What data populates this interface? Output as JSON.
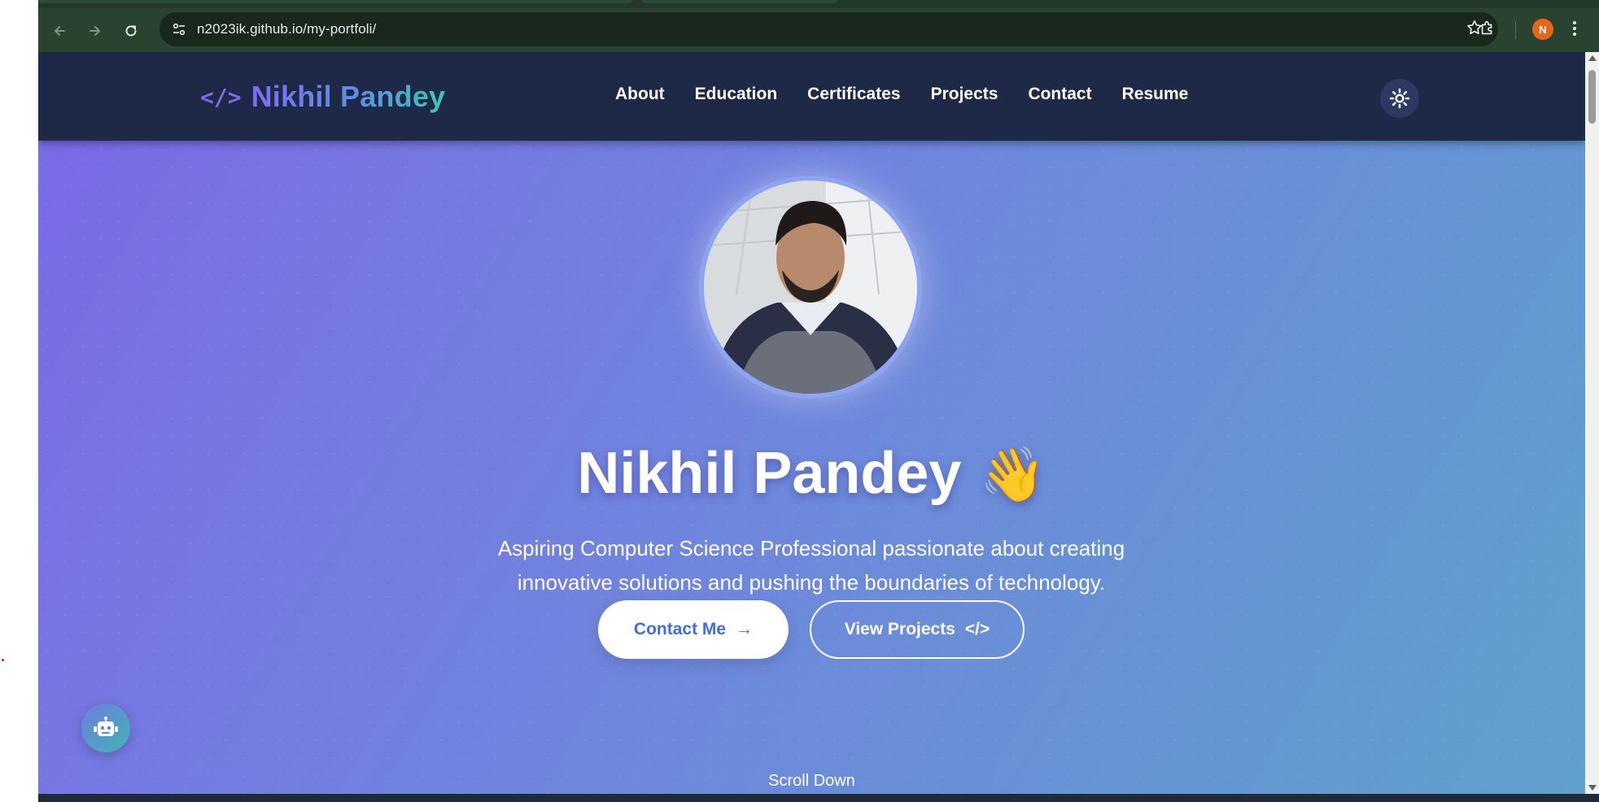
{
  "browser": {
    "url": "n2023ik.github.io/my-portfoli/",
    "back_icon": "arrow-left",
    "forward_icon": "arrow-right",
    "reload_icon": "reload",
    "bookmark_icon": "star",
    "extensions_icon": "puzzle",
    "profile_initial": "N",
    "menu_icon": "kebab"
  },
  "nav": {
    "logo_icon": "</>",
    "logo_first": "Nikhil",
    "logo_last": "Pandey",
    "items": [
      "About",
      "Education",
      "Certificates",
      "Projects",
      "Contact",
      "Resume"
    ],
    "theme_icon": "sun"
  },
  "hero": {
    "title": "Nikhil Pandey",
    "wave_emoji": "👋",
    "subtitle_line1": "Aspiring Computer Science Professional passionate about creating",
    "subtitle_line2": "innovative solutions and pushing the boundaries of technology.",
    "contact_label": "Contact Me",
    "contact_icon": "→",
    "projects_label": "View Projects",
    "projects_icon": "</>",
    "scroll_label": "Scroll Down"
  },
  "colors": {
    "navbar_bg": "#1e2948",
    "hero_gradient_start": "#7b6be6",
    "hero_gradient_end": "#5fa0cc",
    "brand_gradient": [
      "#7f6cf2",
      "#3ec6b0"
    ],
    "button_text": "#3d6fe0",
    "profile_badge": "#e8661a"
  }
}
